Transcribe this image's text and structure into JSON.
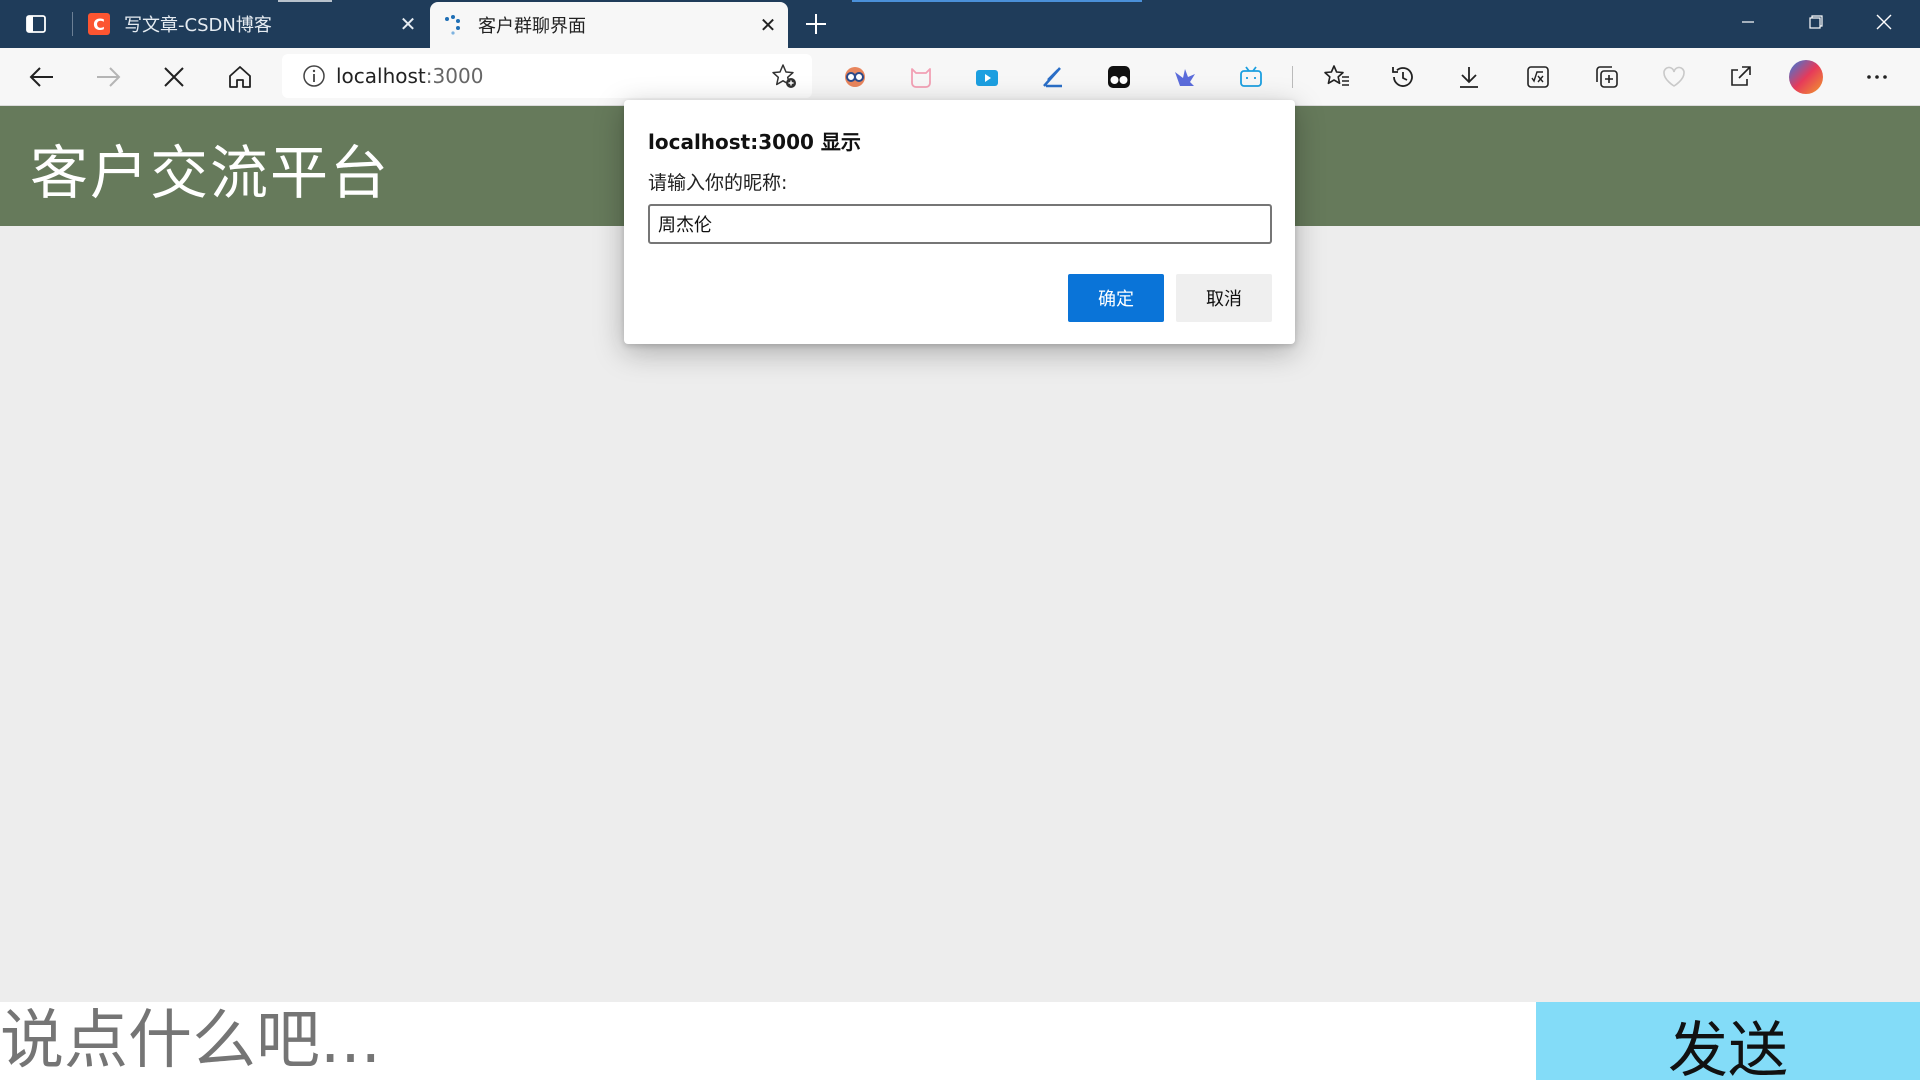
{
  "browser": {
    "tabs": [
      {
        "title": "写文章-CSDN博客",
        "favicon": "csdn-icon",
        "active": false
      },
      {
        "title": "客户群聊界面",
        "favicon": "loading-spinner-icon",
        "active": true
      }
    ],
    "address": {
      "host": "localhost",
      "port": ":3000"
    },
    "colors": {
      "tabbar": "#1f3c5a",
      "toolbar": "#f7f7f7",
      "accent": "#0a74d8"
    }
  },
  "page": {
    "title": "客户交流平台",
    "composer": {
      "placeholder": "说点什么吧...",
      "send_label": "发送"
    },
    "colors": {
      "header": "#667a5b",
      "send": "#83dcf8",
      "background": "#ededed"
    }
  },
  "dialog": {
    "title": "localhost:3000 显示",
    "message": "请输入你的昵称:",
    "input_value": "周杰伦",
    "ok_label": "确定",
    "cancel_label": "取消"
  }
}
